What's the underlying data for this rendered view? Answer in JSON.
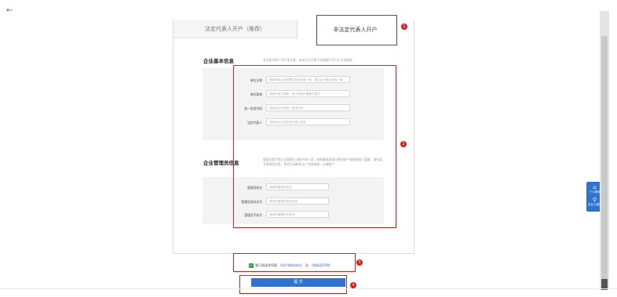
{
  "nav": {
    "back_glyph": "←"
  },
  "tabs": [
    {
      "label": "法定代表人开户（推荐）",
      "active": false
    },
    {
      "label": "非法定代表人开户",
      "active": true
    }
  ],
  "basic_info": {
    "title": "企业基本信息",
    "note": "非法定代表人开户须注意，若本企业不属于招商银行开户企业须授权",
    "fields": [
      {
        "label": "单位全称",
        "placeholder": "请填写单位全称需与营业执照一致，请与企业营业执照一致"
      },
      {
        "label": "单位简称",
        "placeholder": "请填写单位简称，用于在账户管理中显示"
      },
      {
        "label": "统一信用代码",
        "placeholder": "请填写企业的统一信用代码"
      },
      {
        "label": "法定代表人",
        "placeholder": "请填写企业的法定代表人姓名"
      }
    ]
  },
  "admin_info": {
    "title": "企业管理员信息",
    "note": "管理员是代表企业管理企业账户的人员，具有最高权限可操作账户和授权他人管理，请先填写管理员信息，提交后请联系法人完成授权，以便账户",
    "fields": [
      {
        "label": "管理员姓名",
        "placeholder": "请填写管理员姓名"
      },
      {
        "label": "管理员身份证号",
        "placeholder": "请填写管理员身份证号"
      },
      {
        "label": "管理员手机号",
        "placeholder": "请填写管理员手机号"
      }
    ]
  },
  "agreement": {
    "checked": true,
    "prefix": "我已阅读并同意",
    "link1": "《用户服务协议》",
    "joiner": "及",
    "link2": "《隐私权声明》"
  },
  "submit_label": "提 交",
  "badges": [
    "1",
    "2",
    "3",
    "4"
  ],
  "floating_panel": {
    "item1_icon": "⌂",
    "item1_label": "个人服务",
    "item2_icon": "⚲",
    "item2_label": "中企人服务"
  },
  "colors": {
    "accent": "#2e72d2",
    "annotation_red": "#d81e1e",
    "check_green": "#2ea44f"
  }
}
